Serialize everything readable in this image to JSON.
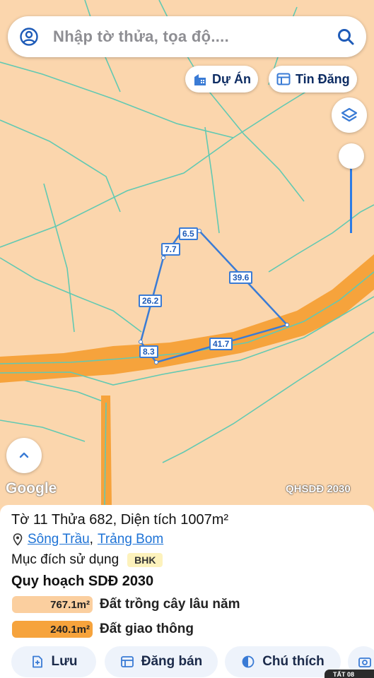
{
  "search": {
    "placeholder": "Nhập tờ thửa, tọa độ...."
  },
  "toolbar": {
    "project_label": "Dự Án",
    "listing_label": "Tin Đăng"
  },
  "map": {
    "attribution": "Google",
    "layer_name": "QHSDĐ 2030",
    "segments": [
      "6.5",
      "7.7",
      "26.2",
      "8.3",
      "41.7",
      "39.6"
    ],
    "colors": {
      "land": "#fbd6ad",
      "road": "#f6a33c",
      "boundary": "#62c9b2",
      "parcel": "#3a7bd5"
    }
  },
  "parcel": {
    "title": "Tờ 11 Thửa 682, Diện tích 1007m²",
    "commune": "Sông Trầu",
    "separator": ",",
    "district": "Trảng Bom",
    "purpose_label": "Mục đích sử dụng",
    "purpose_code": "BHK",
    "plan_title": "Quy hoạch SDĐ 2030",
    "plan": [
      {
        "area": "767.1m²",
        "label": "Đất trồng cây lâu năm",
        "color": "#fbcf9f"
      },
      {
        "area": "240.1m²",
        "label": "Đất giao thông",
        "color": "#f6a33c"
      }
    ]
  },
  "actions": {
    "save": "Lưu",
    "post": "Đăng bán",
    "legend": "Chú thích"
  },
  "status": {
    "corner_text": "TẤT 08"
  }
}
